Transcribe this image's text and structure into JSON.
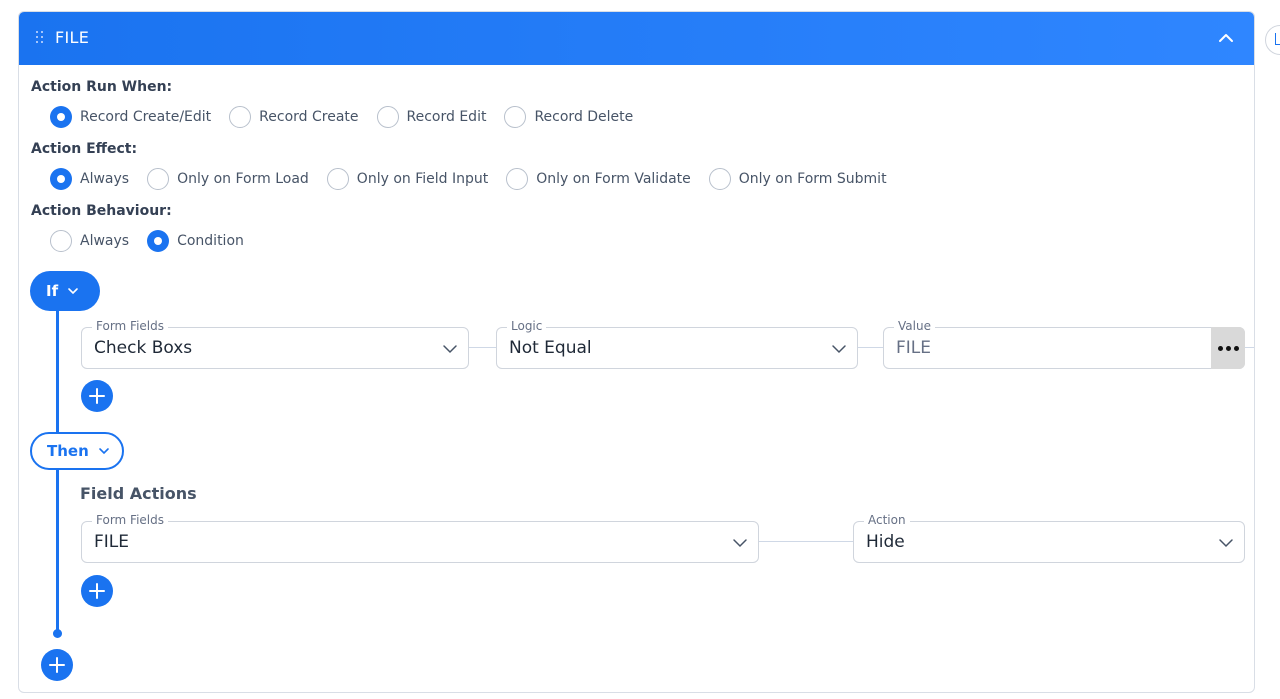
{
  "panel": {
    "title": "FILE"
  },
  "action_run_when": {
    "label": "Action Run When:",
    "options": [
      "Record Create/Edit",
      "Record Create",
      "Record Edit",
      "Record Delete"
    ],
    "selected": "Record Create/Edit"
  },
  "action_effect": {
    "label": "Action Effect:",
    "options": [
      "Always",
      "Only on Form Load",
      "Only on Field Input",
      "Only on Form Validate",
      "Only on Form Submit"
    ],
    "selected": "Always"
  },
  "action_behaviour": {
    "label": "Action Behaviour:",
    "options": [
      "Always",
      "Condition"
    ],
    "selected": "Condition"
  },
  "if_block": {
    "label": "If",
    "form_fields": {
      "label": "Form Fields",
      "value": "Check Boxs"
    },
    "logic": {
      "label": "Logic",
      "value": "Not Equal"
    },
    "value": {
      "label": "Value",
      "value": "FILE"
    }
  },
  "then_block": {
    "label": "Then",
    "heading": "Field Actions",
    "form_fields": {
      "label": "Form Fields",
      "value": "FILE"
    },
    "action": {
      "label": "Action",
      "value": "Hide"
    }
  },
  "colors": {
    "accent": "#1a73f0",
    "border": "#d0d5dd",
    "label": "#475467"
  },
  "icons": {
    "drag": "drag-dots-icon",
    "collapse": "chevron-up-icon",
    "dropdown": "chevron-down-icon",
    "add": "plus-icon",
    "more": "ellipsis-icon",
    "delete": "trash-icon"
  }
}
